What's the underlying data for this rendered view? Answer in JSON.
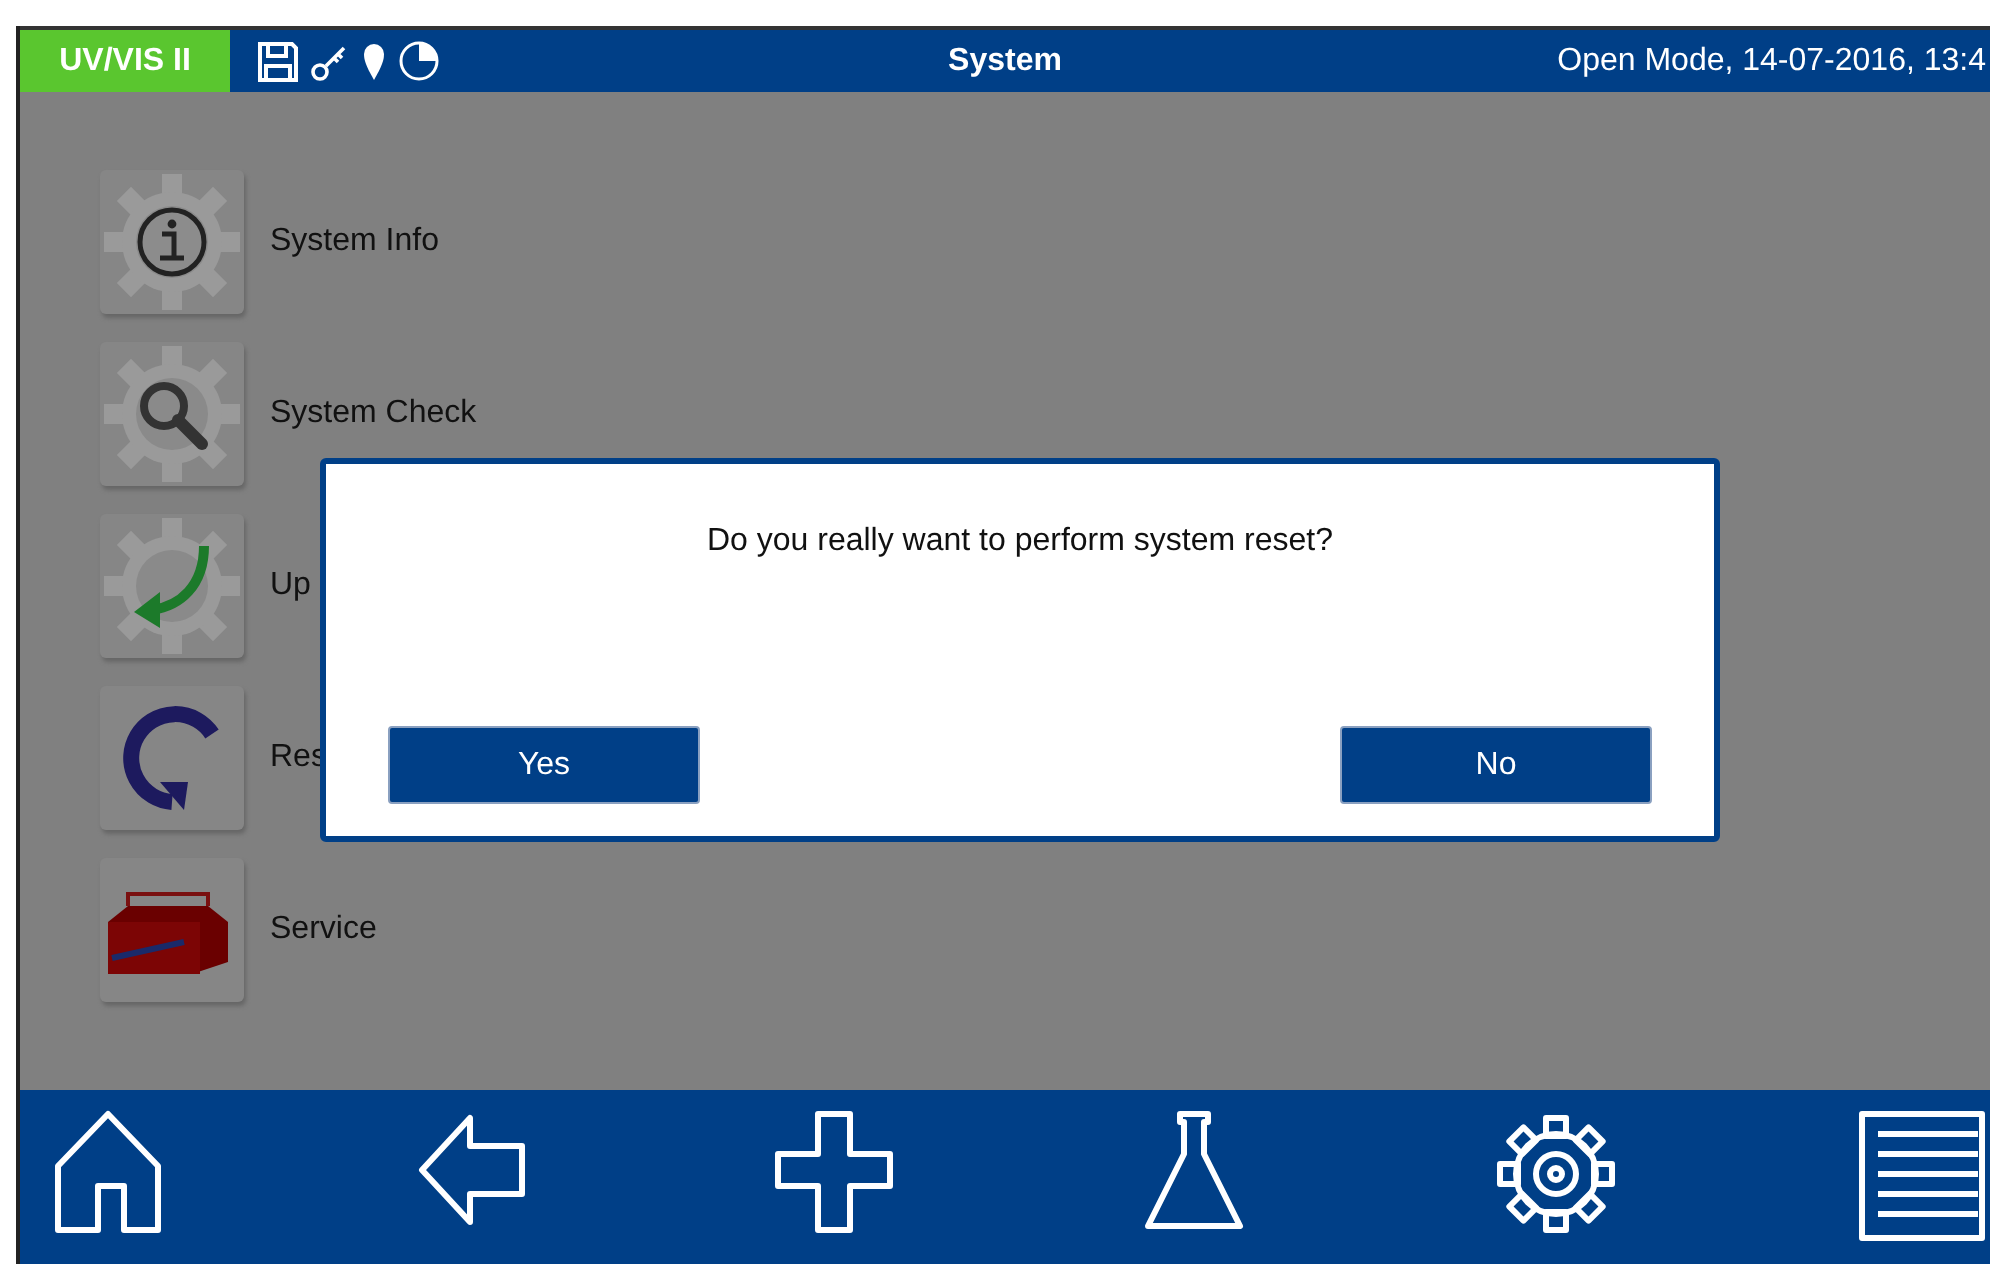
{
  "header": {
    "device": "UV/VIS II",
    "title": "System",
    "status": "Open Mode, 14-07-2016, 13:4"
  },
  "menu": [
    {
      "kind": "info",
      "label": "System Info"
    },
    {
      "kind": "check",
      "label": "System Check"
    },
    {
      "kind": "update",
      "label": "Up"
    },
    {
      "kind": "reset",
      "label": "Res"
    },
    {
      "kind": "service",
      "label": "Service"
    }
  ],
  "dialog": {
    "message": "Do you really want to perform system reset?",
    "buttons": [
      "Yes",
      "No"
    ]
  }
}
